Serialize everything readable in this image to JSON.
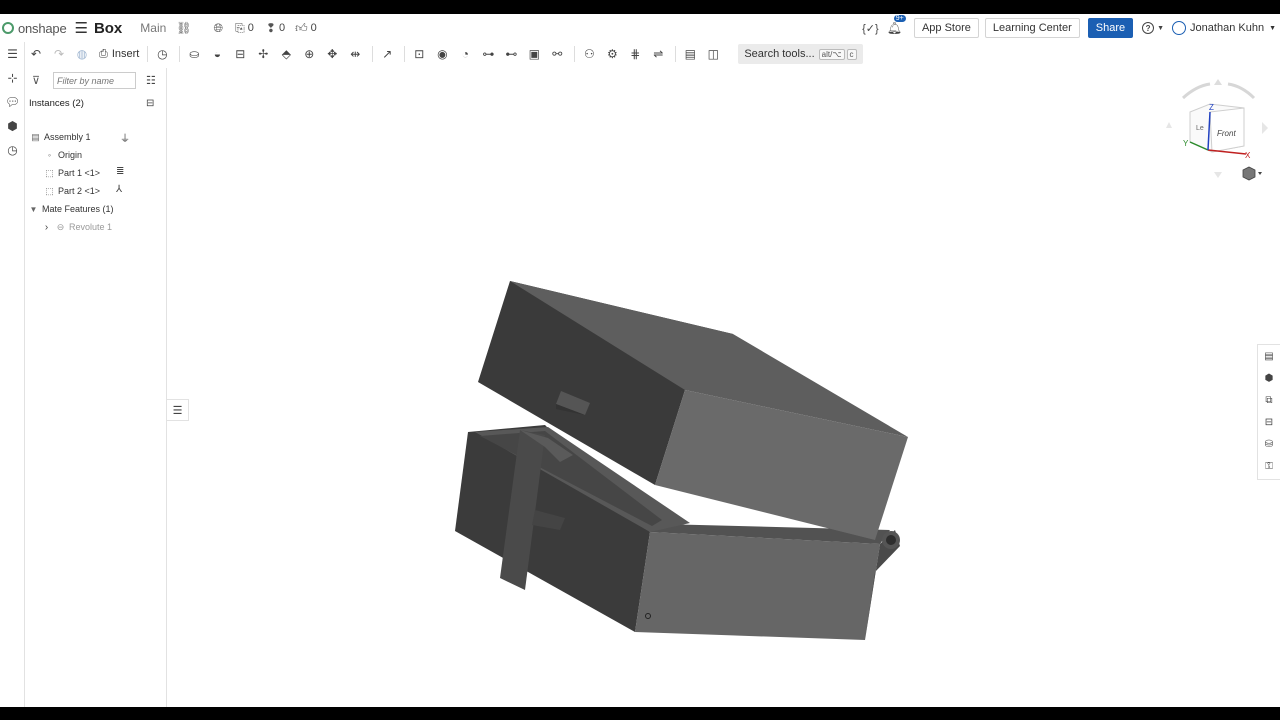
{
  "header": {
    "logo_text": "onshape",
    "doc_title": "Box",
    "workspace": "Main",
    "versions_count": "0",
    "comments_count": "0",
    "likes_count": "0",
    "variable_label": "{✓}",
    "notification_badge": "9+",
    "app_store": "App Store",
    "learning_center": "Learning Center",
    "share": "Share",
    "help_icon": "?",
    "user_name": "Jonathan Kuhn"
  },
  "toolbar": {
    "insert_label": "Insert",
    "search_label": "Search tools...",
    "search_shortcut_1": "alt/⌥",
    "search_shortcut_2": "c"
  },
  "panel": {
    "filter_placeholder": "Filter by name",
    "instances_label": "Instances (2)",
    "tree": [
      {
        "label": "Assembly 1"
      },
      {
        "label": "Origin"
      },
      {
        "label": "Part 1 <1>"
      },
      {
        "label": "Part 2 <1>"
      },
      {
        "label": "Mate Features (1)"
      },
      {
        "label": "Revolute 1"
      }
    ]
  },
  "viewcube": {
    "front_label": "Front",
    "left_label": "Le",
    "axis_x": "X",
    "axis_y": "Y",
    "axis_z": "Z"
  },
  "colors": {
    "share": "#1b5fb3",
    "brand": "#4c9a6a",
    "model_dark": "#3a3a3a",
    "model_mid": "#666666"
  }
}
